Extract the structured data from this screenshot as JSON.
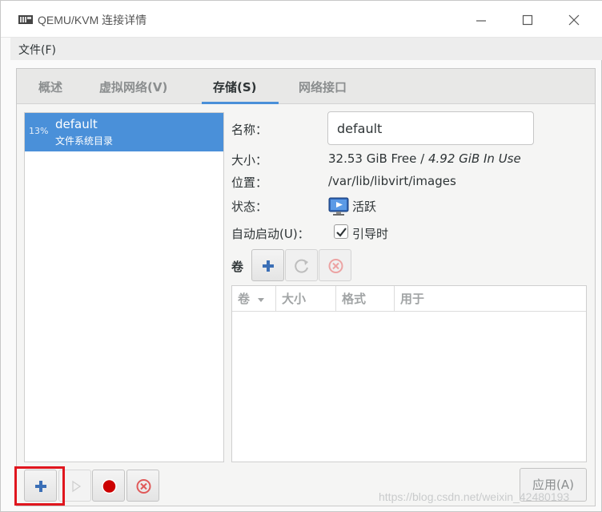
{
  "window": {
    "title": "QEMU/KVM 连接详情"
  },
  "menubar": {
    "file": "文件(F)"
  },
  "tabs": [
    {
      "label": "概述",
      "active": false
    },
    {
      "label": "虚拟网络(V)",
      "active": false
    },
    {
      "label": "存储(S)",
      "active": true
    },
    {
      "label": "网络接口",
      "active": false
    }
  ],
  "pools": [
    {
      "usage": "13%",
      "name": "default",
      "type": "文件系统目录",
      "selected": true
    }
  ],
  "details": {
    "name_label": "名称：",
    "name_value": "default",
    "size_label": "大小：",
    "size_free": "32.53 GiB Free / ",
    "size_inuse": "4.92 GiB In Use",
    "location_label": "位置：",
    "location_value": "/var/lib/libvirt/images",
    "state_label": "状态：",
    "state_value": "活跃",
    "autostart_label": "自动启动(U)：",
    "autostart_value": "引导时",
    "autostart_checked": true,
    "volumes_label": "卷"
  },
  "volume_table": {
    "columns": [
      "卷",
      "大小",
      "格式",
      "用于"
    ],
    "rows": []
  },
  "buttons": {
    "apply": "应用(A)"
  },
  "watermark": "https://blog.csdn.net/weixin_42480193",
  "colors": {
    "selection": "#4a90d9",
    "highlight": "#e0161e",
    "add_icon": "#3b6fb6",
    "stop_icon": "#cc0000",
    "delete_icon": "#e05a5a"
  },
  "icons": {
    "add": "plus-icon",
    "start": "play-icon",
    "stop": "record-stop-icon",
    "delete": "delete-circle-icon",
    "refresh": "refresh-icon",
    "state": "monitor-play-icon"
  }
}
